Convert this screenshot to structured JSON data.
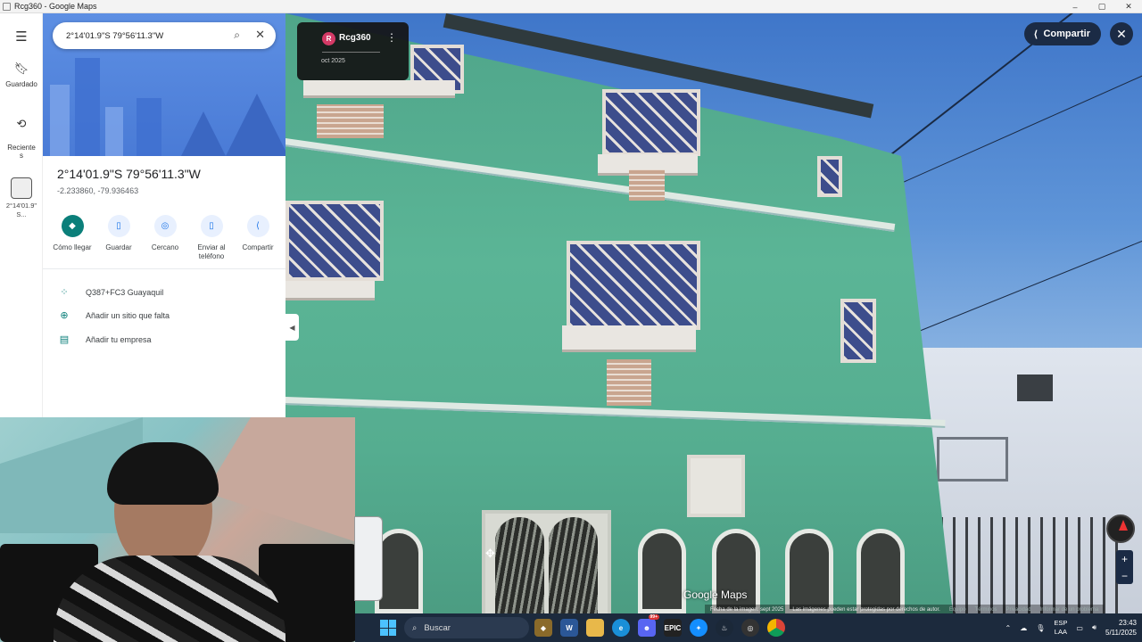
{
  "window": {
    "title": "Rcg360 - Google Maps",
    "minimize": "–",
    "maximize": "▢",
    "close": "✕"
  },
  "rail": {
    "menu_icon": "☰",
    "saved": {
      "icon": "bookmark-icon",
      "label": "Guardado"
    },
    "recent": {
      "icon": "history-icon",
      "label": "Reciente\ns"
    },
    "recent_place_label": "2°14'01.9\"\nS..."
  },
  "search": {
    "value": "2°14'01.9\"S 79°56'11.3\"W"
  },
  "place": {
    "title": "2°14'01.9\"S 79°56'11.3\"W",
    "decimal": "-2.233860, -79.936463",
    "actions": [
      {
        "label": "Cómo llegar",
        "icon": "directions-icon"
      },
      {
        "label": "Guardar",
        "icon": "bookmark-icon"
      },
      {
        "label": "Cercano",
        "icon": "nearby-icon"
      },
      {
        "label": "Enviar al teléfono",
        "icon": "send-to-phone-icon"
      },
      {
        "label": "Compartir",
        "icon": "share-icon"
      }
    ],
    "plus_code": "Q387+FC3 Guayaquil",
    "add_missing": "Añadir un sitio que falta",
    "add_business": "Añadir tu empresa"
  },
  "streetview": {
    "author_initial": "R",
    "author": "Rcg360",
    "date": "oct 2025",
    "share_label": "Compartir",
    "watermark": "Google Maps",
    "footer": {
      "image_date": "Fecha de la imagen: sept 2025",
      "protected": "Las imágenes pueden estar protegidas por derechos de autor.",
      "team": "Equipo",
      "terms": "Términos",
      "privacy": "Privacidad",
      "report": "Informar de un problema"
    },
    "zoom_in": "+",
    "zoom_out": "−"
  },
  "taskbar": {
    "search_label": "Buscar",
    "lang_top": "ESP",
    "lang_bottom": "LAA",
    "time": "23:43",
    "date": "5/11/2025",
    "badge": "99+"
  }
}
